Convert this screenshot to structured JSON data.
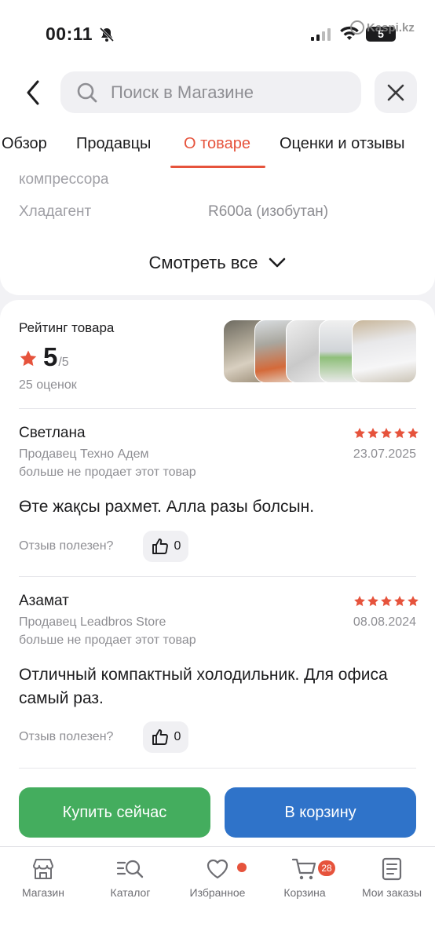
{
  "status_bar": {
    "time": "00:11",
    "battery": "5",
    "watermark": "Kaspi.kz"
  },
  "header": {
    "search_placeholder": "Поиск в Магазине"
  },
  "tabs": [
    {
      "label": "Обзор"
    },
    {
      "label": "Продавцы"
    },
    {
      "label": "О товаре"
    },
    {
      "label": "Оценки и отзывы"
    }
  ],
  "active_tab": "О товаре",
  "specs": {
    "partial_row": "компрессора",
    "rows": [
      {
        "key": "Хладагент",
        "value": "R600a (изобутан)"
      }
    ],
    "see_all": "Смотреть все"
  },
  "rating": {
    "label": "Рейтинг товара",
    "value": "5",
    "out_of": "/5",
    "count": "25 оценок",
    "stars_color": "#e6533c"
  },
  "reviews": [
    {
      "author": "Светлана",
      "stars": 5,
      "seller": "Продавец Техно Адем",
      "date": "23.07.2025",
      "note": "больше не продает этот товар",
      "text": "Өте жақсы рахмет. Алла разы болсын.",
      "useful_label": "Отзыв полезен?",
      "likes": "0"
    },
    {
      "author": "Азамат",
      "stars": 5,
      "seller": "Продавец Leadbros Store",
      "date": "08.08.2024",
      "note": "больше не продает этот товар",
      "text": "Отличный компактный холодильник. Для офиса самый раз.",
      "useful_label": "Отзыв полезен?",
      "likes": "0"
    }
  ],
  "actions": {
    "buy_now": "Купить сейчас",
    "add_to_cart": "В корзину",
    "buy_color": "#44ad5e",
    "cart_color": "#2f73c9"
  },
  "bottom_nav": [
    {
      "label": "Магазин",
      "icon": "store-icon"
    },
    {
      "label": "Каталог",
      "icon": "catalog-icon"
    },
    {
      "label": "Избранное",
      "icon": "heart-icon"
    },
    {
      "label": "Корзина",
      "icon": "cart-icon",
      "badge": "28"
    },
    {
      "label": "Мои заказы",
      "icon": "orders-icon"
    }
  ],
  "accent_color": "#e6533c"
}
